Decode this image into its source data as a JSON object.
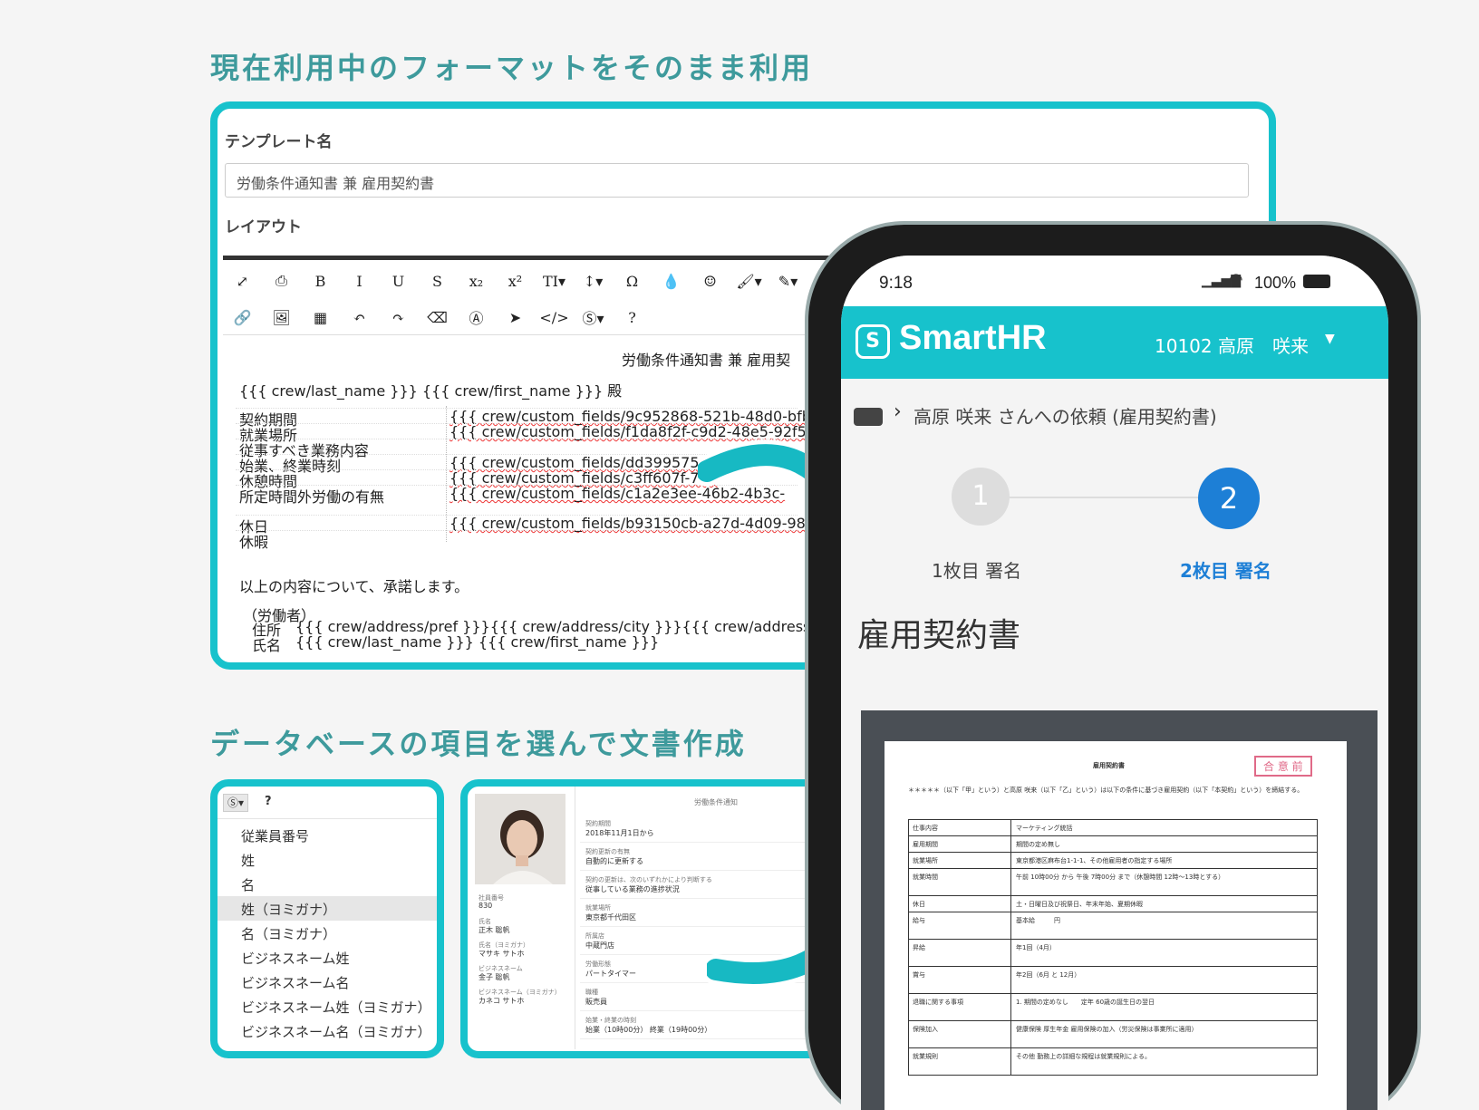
{
  "headings": {
    "top": "現在利用中のフォーマットをそのまま利用",
    "bottom": "データベースの項目を選んで文書作成"
  },
  "editor": {
    "template_name_label": "テンプレート名",
    "template_name_value": "労働条件通知書 兼 雇用契約書",
    "layout_label": "レイアウト",
    "toolbar_row1": [
      "⤢",
      "⎙",
      "B",
      "I",
      "U",
      "S",
      "x₂",
      "x²",
      "TI▾",
      "↕▾",
      "Ω",
      "💧",
      "☺",
      "🖌▾",
      "✎▾"
    ],
    "toolbar_row2": [
      "🔗",
      "🖼",
      "▦",
      "↶",
      "↷",
      "⌫",
      "Ⓐ",
      "➤",
      "</>",
      "Ⓢ▾",
      "?"
    ],
    "doc": {
      "title": "労働条件通知書 兼 雇用契",
      "recipient": "{{{ crew/last_name }}} {{{ crew/first_name }}} 殿",
      "rows": [
        {
          "label": "契約期間",
          "value": "{{{ crew/custom_fields/9c952868-521b-48d0-bfb0"
        },
        {
          "label": "就業場所",
          "value": "{{{ crew/custom_fields/f1da8f2f-c9d2-48e5-92f5-("
        },
        {
          "label": "従事すべき業務内容",
          "value": ""
        },
        {
          "label": "始業、終業時刻",
          "value": "{{{ crew/custom_fields/dd399575-b26("
        },
        {
          "label": "休憩時間",
          "value": "{{{ crew/custom_fields/c3ff607f-7b6"
        },
        {
          "label": "所定時間外労働の有無",
          "value": "{{{ crew/custom_fields/c1a2e3ee-46b2-4b3c-"
        },
        {
          "label": "休日",
          "value": "{{{ crew/custom_fields/b93150cb-a27d-4d09-9892"
        },
        {
          "label": "休暇",
          "value": ""
        }
      ],
      "agreement": "以上の内容について、承諾します。",
      "worker_label": "（労働者）",
      "address_label": "住所",
      "address_value": "{{{ crew/address/pref }}}{{{ crew/address/city }}}{{{ crew/address/street",
      "name_label": "氏名",
      "name_value": "{{{ crew/last_name }}} {{{ crew/first_name }}}"
    }
  },
  "db_panel": {
    "toolbar_icon": "Ⓢ▾",
    "toolbar_help": "?",
    "items": [
      "従業員番号",
      "姓",
      "名",
      "姓（ヨミガナ）",
      "名（ヨミガナ）",
      "ビジネスネーム姓",
      "ビジネスネーム名",
      "ビジネスネーム姓（ヨミガナ）",
      "ビジネスネーム名（ヨミガナ）"
    ],
    "selected_index": 3
  },
  "profile_panel": {
    "doc_title": "労働条件通知",
    "left_fields": [
      {
        "label": "社員番号",
        "value": "830"
      },
      {
        "label": "氏名",
        "value": "正木 聡帆"
      },
      {
        "label": "氏名（ヨミガナ）",
        "value": "マサキ サトホ"
      },
      {
        "label": "ビジネスネーム",
        "value": "金子 聡帆"
      },
      {
        "label": "ビジネスネーム（ヨミガナ）",
        "value": "カネコ サトホ"
      }
    ],
    "right_fields": [
      {
        "label": "契約期間",
        "value": "2018年11月1日から"
      },
      {
        "label": "契約更新の有無",
        "value": "自動的に更新する"
      },
      {
        "label": "契約の更新は、次のいずれかにより判断する",
        "value": "従事している業務の進捗状況"
      },
      {
        "label": "就業場所",
        "value": "東京都千代田区"
      },
      {
        "label": "所属店",
        "value": "中蔵門店"
      },
      {
        "label": "労働形態",
        "value": "パートタイマー"
      },
      {
        "label": "職種",
        "value": "販売員"
      },
      {
        "label": "始業・終業の時刻",
        "value": "始業（10時00分） 終業（19時00分）"
      }
    ]
  },
  "phone": {
    "time": "9:18",
    "battery": "100%",
    "app_name": "SmartHR",
    "user": "10102 高原　咲来",
    "breadcrumb": "高原 咲来 さんへの依頼 (雇用契約書)",
    "steps": [
      {
        "number": "1",
        "label": "1枚目 署名",
        "active": false
      },
      {
        "number": "2",
        "label": "2枚目 署名",
        "active": true
      }
    ],
    "doc_heading": "雇用契約書",
    "preview": {
      "title": "雇用契約書",
      "stamp": "合 意 前",
      "intro": "＊＊＊＊＊（以下「甲」という）と高原 咲来（以下「乙」という）は以下の条件に基づき雇用契約（以下「本契約」という）を締結する。",
      "rows": [
        {
          "label": "仕事内容",
          "value": "マーケティング統括"
        },
        {
          "label": "雇用期間",
          "value": "期間の定め無し"
        },
        {
          "label": "就業場所",
          "value": "東京都港区麻布台1-1-1、その他雇用者の指定する場所"
        },
        {
          "label": "就業時間",
          "value": "午前 10時00分 から 午後 7時00分 まで（休憩時間 12時〜13時とする）"
        },
        {
          "label": "休日",
          "value": "土・日曜日及び祝祭日、年末年始、夏期休暇"
        },
        {
          "label": "給与",
          "value": "基本給　　　円"
        },
        {
          "label": "昇給",
          "value": "年1回（4月）"
        },
        {
          "label": "賞与",
          "value": "年2回（6月 と 12月）"
        },
        {
          "label": "退職に関する事項",
          "value": "1. 期間の定めなし　　定年 60歳の誕生日の翌日"
        },
        {
          "label": "保険加入",
          "value": "健康保険 厚生年金 雇用保険の加入（労災保険は事業所に適用）"
        },
        {
          "label": "就業規則",
          "value": "その他 勤務上の詳細な規程は就業規則による。"
        }
      ]
    }
  },
  "colors": {
    "accent": "#17c2cc",
    "heading": "#3e9a9c",
    "active_step": "#1d7fd6",
    "background": "#f5f5f5"
  }
}
